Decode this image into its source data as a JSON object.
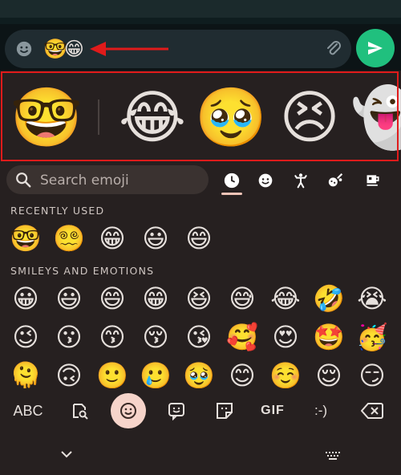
{
  "compose": {
    "message": "🤓😁"
  },
  "suggestions": [
    {
      "emoji": "🤓"
    },
    {
      "emoji": "😂"
    },
    {
      "emoji": "🥹"
    },
    {
      "emoji": "😣"
    },
    {
      "emoji": "👻"
    }
  ],
  "search": {
    "placeholder": "Search emoji"
  },
  "categories": [
    "clock-icon",
    "smiley-icon",
    "person-icon",
    "activities-icon",
    "coffee-icon"
  ],
  "sections": {
    "recent_label": "RECENTLY USED",
    "smileys_label": "SMILEYS AND EMOTIONS"
  },
  "recent": [
    "🤓",
    "😵‍💫",
    "😁",
    "😃",
    "😄"
  ],
  "smileys": [
    [
      "😀",
      "😃",
      "😄",
      "😁",
      "😆",
      "😅",
      "😂",
      "🤣",
      "😭"
    ],
    [
      "😉",
      "😗",
      "😙",
      "😚",
      "😘",
      "🥰",
      "😍",
      "🤩",
      "🥳"
    ],
    [
      "🫠",
      "🙃",
      "🙂",
      "🥲",
      "🥹",
      "😊",
      "☺️",
      "😌",
      "😏"
    ]
  ],
  "keyboard_bar": {
    "abc": "ABC",
    "gif": "GIF",
    "emoticon": ":-)"
  },
  "colors": {
    "accent_red": "#e01b1b",
    "send_green": "#20c07e",
    "active_pill": "#f6d4ca"
  }
}
